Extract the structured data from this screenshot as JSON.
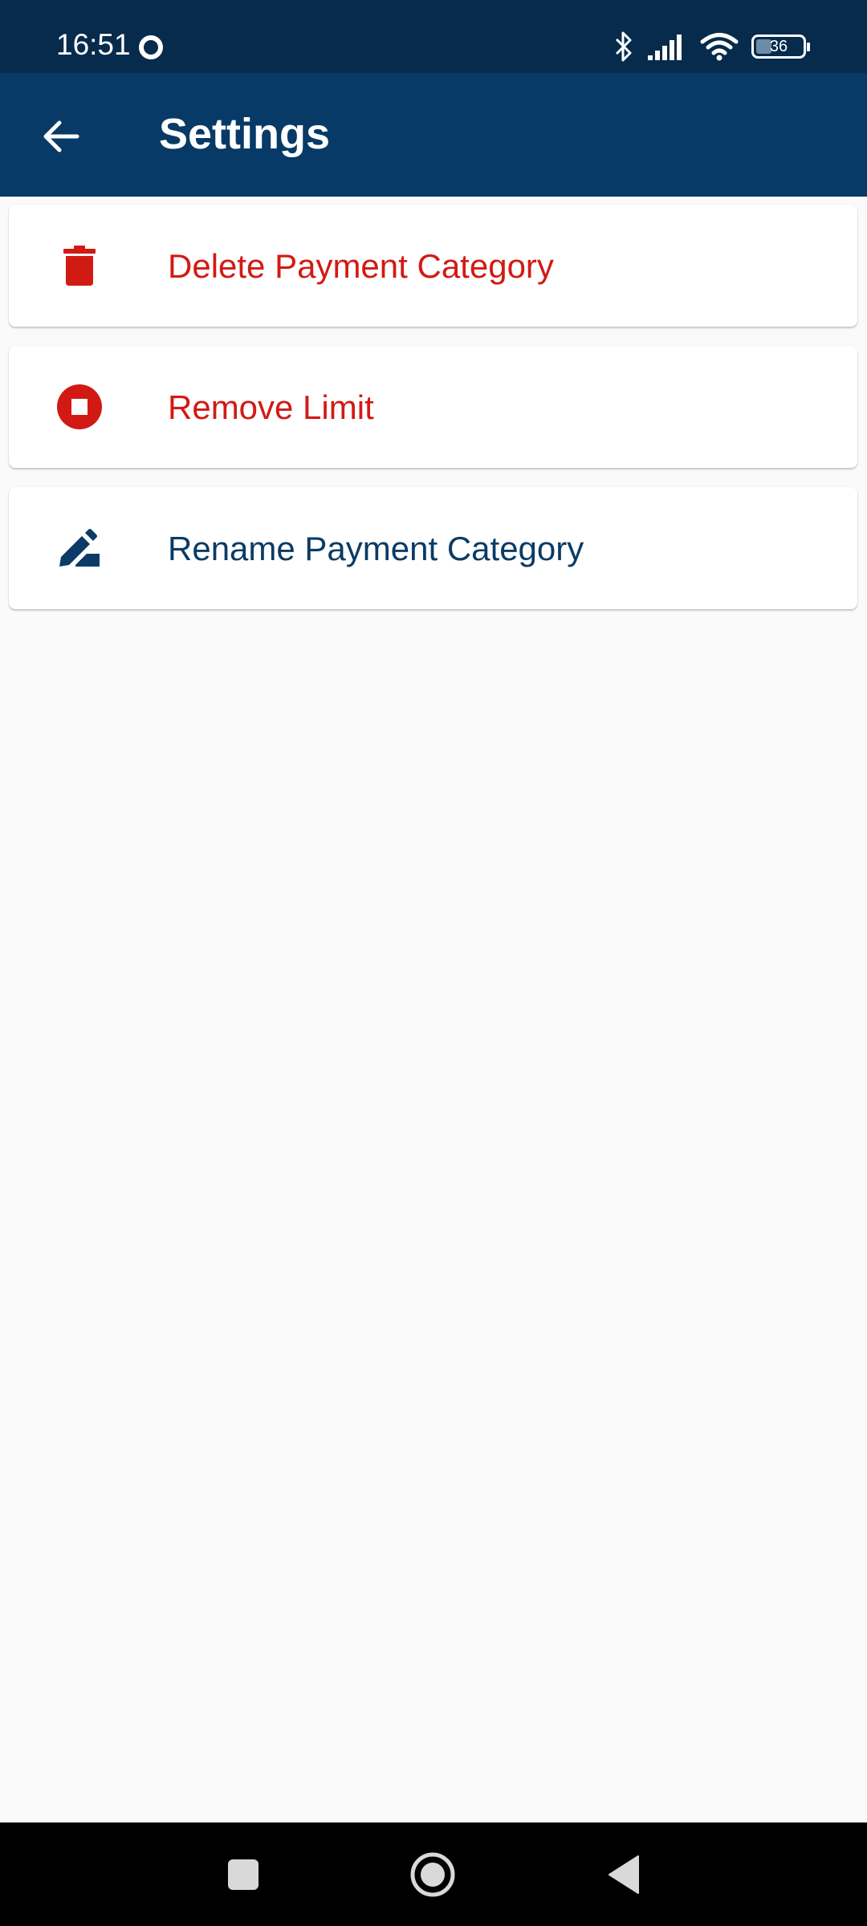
{
  "status_bar": {
    "time": "16:51",
    "battery_level": "36",
    "icons": [
      "ring-icon",
      "bluetooth-icon",
      "signal-icon",
      "wifi-icon",
      "battery-icon"
    ]
  },
  "app_bar": {
    "title": "Settings",
    "back_icon": "arrow-left-icon"
  },
  "options": [
    {
      "label": "Delete Payment Category",
      "icon": "trash-icon",
      "color": "#d21a14"
    },
    {
      "label": "Remove Limit",
      "icon": "stop-circle-icon",
      "color": "#d21a14"
    },
    {
      "label": "Rename Payment Category",
      "icon": "edit-pencil-icon",
      "color": "#0b3b66"
    }
  ],
  "nav_bar": {
    "buttons": [
      "recents-square-icon",
      "home-circle-icon",
      "back-triangle-icon"
    ]
  },
  "colors": {
    "status_bar_bg": "#062b4c",
    "app_bar_bg": "#073a66",
    "page_bg": "#fafafa",
    "destructive": "#d21a14",
    "primary_text": "#0b3b66"
  }
}
